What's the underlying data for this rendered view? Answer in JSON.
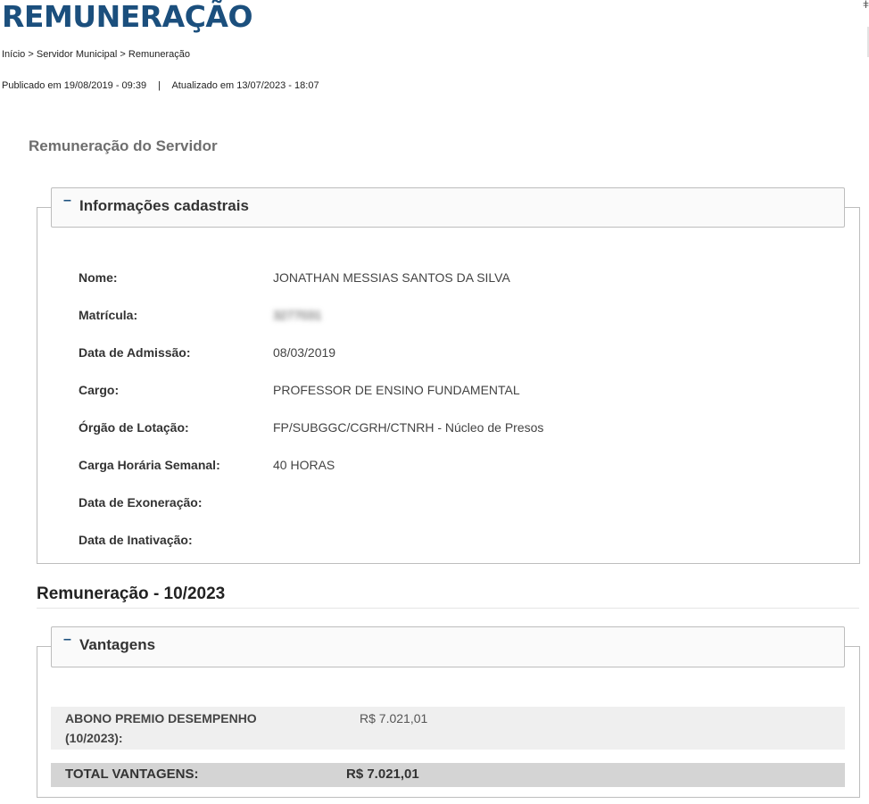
{
  "page": {
    "title": "REMUNERAÇÃO",
    "breadcrumb": {
      "home": "Início",
      "section": "Servidor Municipal",
      "current": "Remuneração",
      "separator": ">"
    },
    "published": "Publicado em 19/08/2019 - 09:39",
    "separator": "|",
    "updated": "Atualizado em 13/07/2023 - 18:07",
    "side_glyph": "ǂ"
  },
  "section_title": "Remuneração do Servidor",
  "info_panel": {
    "legend": "Informações cadastrais",
    "collapse_icon": "collapse-minus-icon",
    "fields": [
      {
        "label": "Nome:",
        "value": "JONATHAN MESSIAS SANTOS DA SILVA"
      },
      {
        "label": "Matrícula:",
        "value": "3277031"
      },
      {
        "label": "Data de Admissão:",
        "value": "08/03/2019"
      },
      {
        "label": "Cargo:",
        "value": "PROFESSOR DE ENSINO FUNDAMENTAL"
      },
      {
        "label": "Órgão de Lotação:",
        "value": "FP/SUBGGC/CGRH/CTNRH - Núcleo de Presos"
      },
      {
        "label": "Carga Horária Semanal:",
        "value": "40 HORAS"
      },
      {
        "label": "Data de Exoneração:",
        "value": ""
      },
      {
        "label": "Data de Inativação:",
        "value": ""
      }
    ]
  },
  "remuneration": {
    "title": "Remuneração - 10/2023",
    "vantagens": {
      "legend": "Vantagens",
      "items": [
        {
          "label": "ABONO PREMIO DESEMPENHO (10/2023):",
          "value": "R$ 7.021,01"
        }
      ],
      "total": {
        "label": "TOTAL VANTAGENS:",
        "value": "R$ 7.021,01"
      }
    }
  },
  "colors": {
    "brand_blue": "#1b4f7d",
    "legend_bg": "#fafafa",
    "row_bg": "#efefef",
    "total_bg": "#d4d4d4"
  }
}
